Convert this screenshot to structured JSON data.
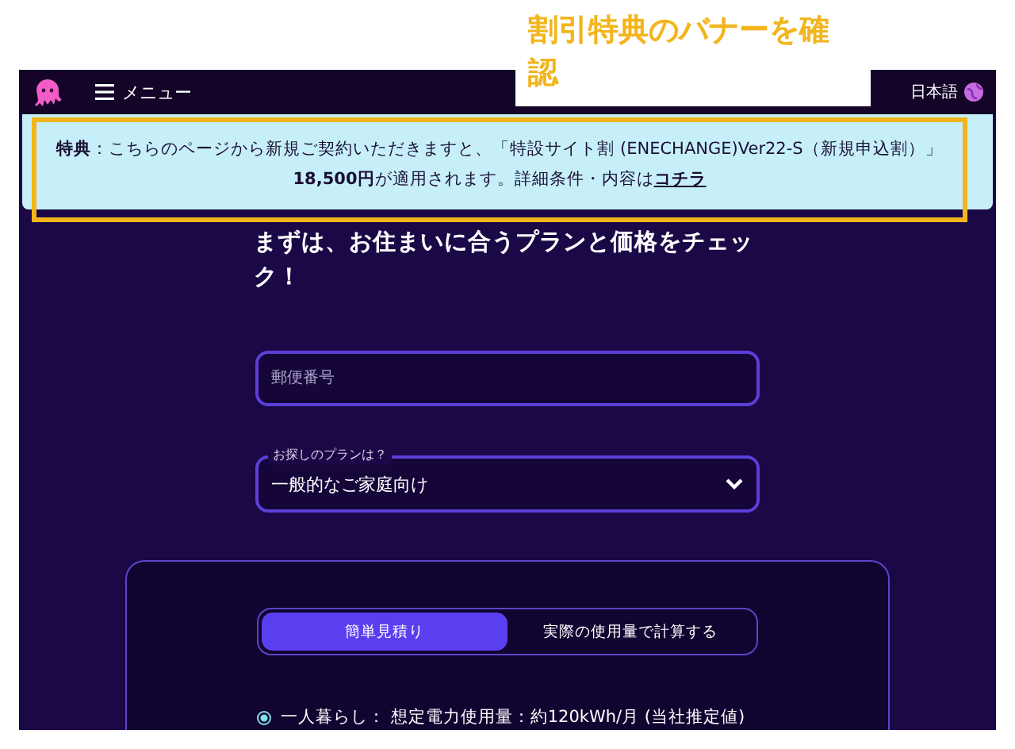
{
  "annotation": {
    "text": "割引特典のバナーを確認"
  },
  "header": {
    "menu_label": "メニュー",
    "language": "日本語"
  },
  "banner": {
    "text": "**特典**：こちらのページから新規ご契約いただきますと、「特設サイト割 (ENECHANGE)Ver22-S（新規申込割）」\n**18,500円**が適用されます。詳細条件・内容は",
    "link": "コチラ"
  },
  "heading": "まずは、お住まいに合うプランと価格をチェック！",
  "postal_field": {
    "placeholder": "郵便番号"
  },
  "plan_select": {
    "label": "お探しのプランは？",
    "value": "一般的なご家庭向け"
  },
  "estimate_tabs": [
    {
      "label": "簡単見積り",
      "selected": true
    },
    {
      "label": "実際の使用量で計算する",
      "selected": false
    }
  ],
  "household_options": [
    {
      "label": "一人暮らし： 想定電力使用量：約120kWh/月 (当社推定値)",
      "selected": true
    }
  ]
}
